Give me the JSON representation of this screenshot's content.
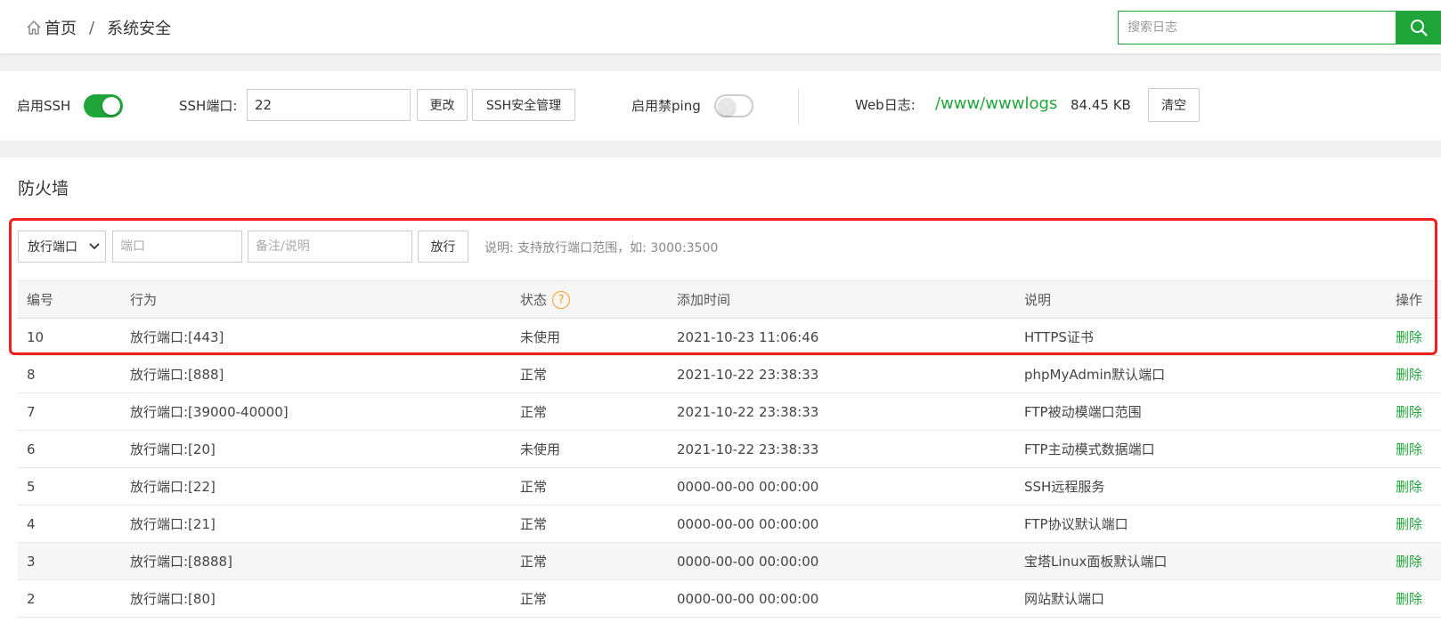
{
  "header": {
    "breadcrumb": {
      "home": "首页",
      "separator": "/",
      "current": "系统安全"
    },
    "search": {
      "placeholder": "搜索日志"
    }
  },
  "ssh": {
    "enable_ssh_label": "启用SSH",
    "enable_ssh": true,
    "port_label": "SSH端口:",
    "port_value": "22",
    "change_button": "更改",
    "manage_button": "SSH安全管理",
    "ping_label": "启用禁ping",
    "ping_enabled": false,
    "web_log_label": "Web日志:",
    "web_log_path": "/www/wwwlogs",
    "web_log_size": "84.45 KB",
    "clear_button": "清空"
  },
  "firewall": {
    "title": "防火墙",
    "form": {
      "type_selected": "放行端口",
      "port_placeholder": "端口",
      "note_placeholder": "备注/说明",
      "submit_button": "放行",
      "hint": "说明: 支持放行端口范围，如: 3000:3500"
    },
    "columns": {
      "id": "编号",
      "action": "行为",
      "status": "状态",
      "added": "添加时间",
      "desc": "说明",
      "op": "操作"
    },
    "rows": [
      {
        "id": "10",
        "action": "放行端口:[443]",
        "status": "未使用",
        "added": "2021-10-23 11:06:46",
        "desc": "HTTPS证书",
        "op": "删除"
      },
      {
        "id": "8",
        "action": "放行端口:[888]",
        "status": "正常",
        "added": "2021-10-22 23:38:33",
        "desc": "phpMyAdmin默认端口",
        "op": "删除"
      },
      {
        "id": "7",
        "action": "放行端口:[39000-40000]",
        "status": "正常",
        "added": "2021-10-22 23:38:33",
        "desc": "FTP被动模端口范围",
        "op": "删除"
      },
      {
        "id": "6",
        "action": "放行端口:[20]",
        "status": "未使用",
        "added": "2021-10-22 23:38:33",
        "desc": "FTP主动模式数据端口",
        "op": "删除"
      },
      {
        "id": "5",
        "action": "放行端口:[22]",
        "status": "正常",
        "added": "0000-00-00 00:00:00",
        "desc": "SSH远程服务",
        "op": "删除"
      },
      {
        "id": "4",
        "action": "放行端口:[21]",
        "status": "正常",
        "added": "0000-00-00 00:00:00",
        "desc": "FTP协议默认端口",
        "op": "删除"
      },
      {
        "id": "3",
        "action": "放行端口:[8888]",
        "status": "正常",
        "added": "0000-00-00 00:00:00",
        "desc": "宝塔Linux面板默认端口",
        "op": "删除"
      },
      {
        "id": "2",
        "action": "放行端口:[80]",
        "status": "正常",
        "added": "0000-00-00 00:00:00",
        "desc": "网站默认端口",
        "op": "删除"
      }
    ]
  },
  "colors": {
    "accent": "#20a53a",
    "highlight": "#f02020",
    "help": "#f0a020"
  }
}
